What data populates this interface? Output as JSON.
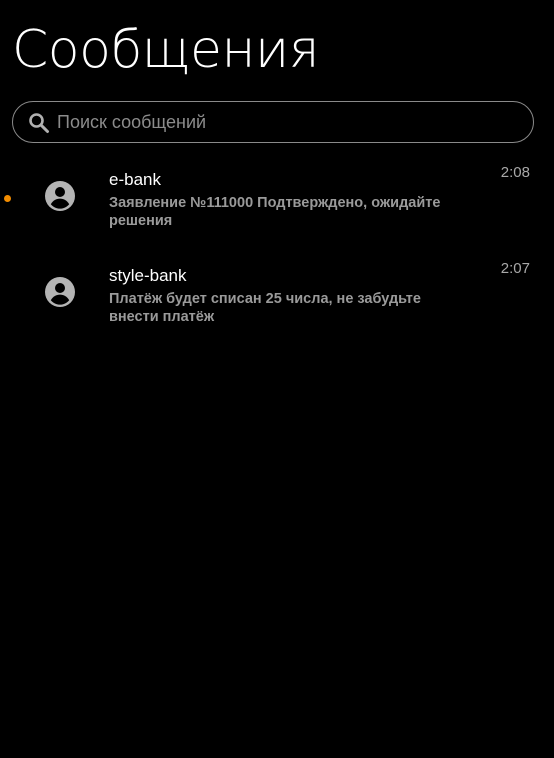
{
  "header": {
    "title": "Сообщения"
  },
  "search": {
    "placeholder": "Поиск сообщений",
    "value": "",
    "icon": "search-icon"
  },
  "colors": {
    "background": "#000000",
    "unread_indicator": "#f28c00",
    "secondary_text": "#9a9a9a",
    "border": "#8a8a8a"
  },
  "messages": [
    {
      "sender": "e-bank",
      "preview": "Заявление №111000 Подтверждено, ожидайте решения",
      "time": "2:08",
      "unread": true,
      "icon": "account-circle-icon"
    },
    {
      "sender": "style-bank",
      "preview": "Платёж будет списан 25 числа, не забудьте внести платёж",
      "time": "2:07",
      "unread": false,
      "icon": "account-circle-icon"
    }
  ]
}
